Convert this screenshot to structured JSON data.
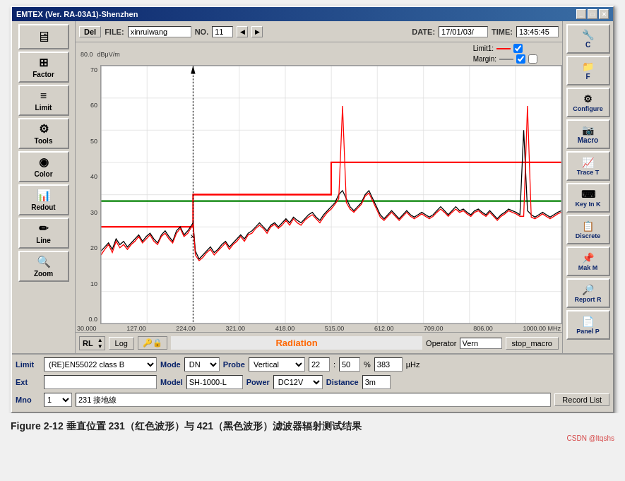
{
  "window": {
    "title": "EMTEX (Ver. RA-03A1)-Shenzhen",
    "title_buttons": [
      "_",
      "□",
      "✕"
    ]
  },
  "toolbar": {
    "del_label": "Del",
    "file_label": "FILE:",
    "file_value": "xinruiwang",
    "no_label": "NO.",
    "no_value": "11",
    "date_label": "DATE:",
    "date_value": "17/01/03/",
    "time_label": "TIME:",
    "time_value": "13:45:45"
  },
  "chart": {
    "y_unit": "dBμV/m",
    "y_max": "80.0",
    "y_ticks": [
      "70",
      "60",
      "50",
      "40",
      "30",
      "20",
      "10",
      "0.0"
    ],
    "x_ticks": [
      "30.000",
      "127.00",
      "224.00",
      "321.00",
      "418.00",
      "515.00",
      "612.00",
      "709.00",
      "806.00",
      "1000.00 MHz"
    ],
    "legend": {
      "limit1_label": "Limit1:",
      "margin_label": "Margin:"
    }
  },
  "left_sidebar": {
    "buttons": [
      {
        "label": "Factor",
        "icon": "⊞"
      },
      {
        "label": "Limit",
        "icon": "≡"
      },
      {
        "label": "Tools",
        "icon": "⚙"
      },
      {
        "label": "Color",
        "icon": "◉"
      },
      {
        "label": "Redout",
        "icon": "📊"
      },
      {
        "label": "Line",
        "icon": "✏"
      },
      {
        "label": "Zoom",
        "icon": "🔍"
      }
    ]
  },
  "right_sidebar": {
    "buttons": [
      {
        "label": "C",
        "icon": "🔧"
      },
      {
        "label": "F",
        "icon": "📁"
      },
      {
        "label": "Configure",
        "icon": "⚙"
      },
      {
        "label": "Macro",
        "icon": "📷"
      },
      {
        "label": "Trace T",
        "icon": "📈"
      },
      {
        "label": "Key In K",
        "icon": "⌨"
      },
      {
        "label": "Discrete",
        "icon": "📋"
      },
      {
        "label": "Mak M",
        "icon": "📌"
      },
      {
        "label": "Report R",
        "icon": "🔎"
      },
      {
        "label": "Panel P",
        "icon": "📄"
      }
    ]
  },
  "bottom_toolbar": {
    "rl_label": "RL",
    "log_label": "Log",
    "center_label": "Radiation",
    "operator_label": "Operator",
    "operator_value": "Vern",
    "stop_macro_label": "stop_macro"
  },
  "bottom_panels": {
    "limit_label": "Limit",
    "limit_value": "(RE)EN55022 class B",
    "mode_label": "Mode",
    "mode_value": "DN",
    "probe_label": "Probe",
    "probe_value": "Vertical",
    "field1_value": "22",
    "field2_value": "50",
    "field3_value": "383",
    "unit_label": "µHz",
    "ext_label": "Ext",
    "ext_value": "",
    "model_label": "Model",
    "model_value": "SH-1000-L",
    "power_label": "Power",
    "power_value": "DC12V",
    "distance_label": "Distance",
    "distance_value": "3m",
    "mno_label": "Mno",
    "mno_value": "1",
    "mno_text": "231 接地線",
    "record_list_label": "Record List"
  },
  "caption": {
    "text": "Figure 2-12  垂直位置 231（红色波形）与 421（黑色波形）滤波器辐射测试结果"
  },
  "watermark": {
    "text": "CSDN @ltqshs"
  }
}
